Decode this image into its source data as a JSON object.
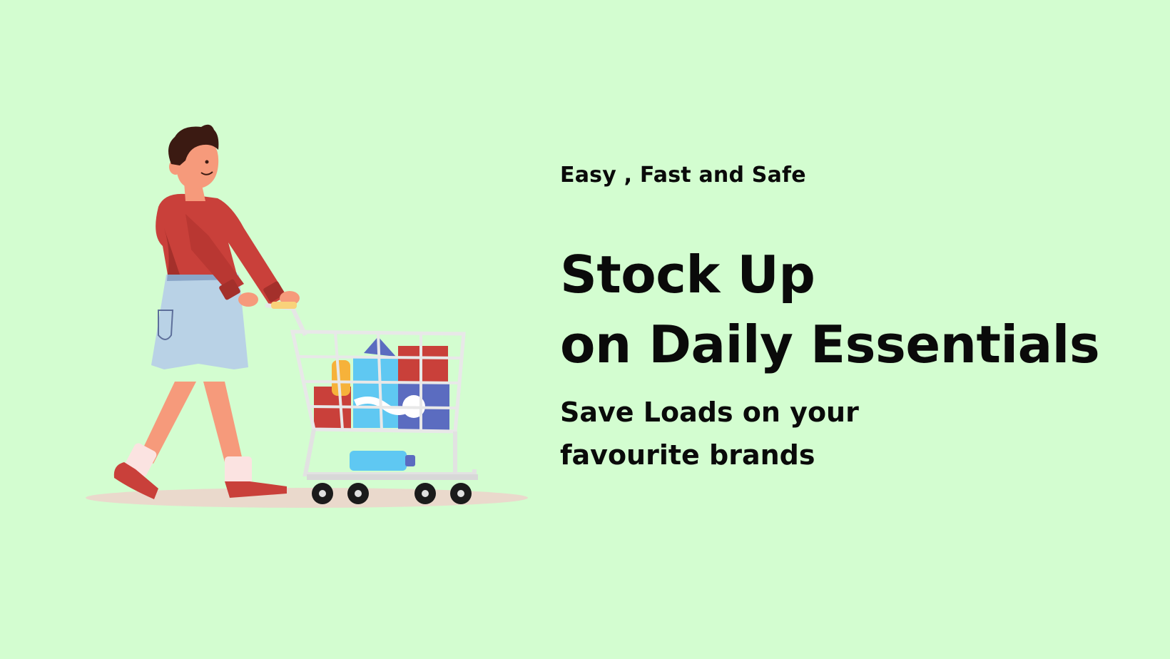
{
  "banner": {
    "tagline": "Easy , Fast and Safe",
    "headline": {
      "line1": "Stock Up",
      "line2": "on Daily Essentials"
    },
    "subheadline": {
      "line1": "Save Loads on your",
      "line2": "favourite brands"
    }
  },
  "illustration": {
    "subject": "man-pushing-shopping-cart-icon"
  },
  "colors": {
    "background": "#d3fdd0",
    "text": "#0a0a0a",
    "sweater": "#c9403a",
    "shorts": "#b9d2e6",
    "skin": "#f69a7b",
    "cart": "#f0f0f0"
  }
}
